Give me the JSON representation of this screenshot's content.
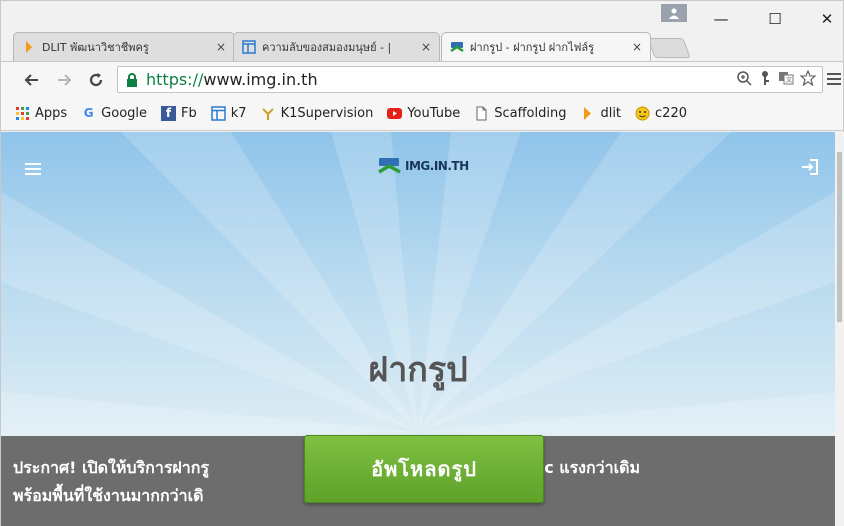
{
  "tabs": [
    {
      "title": "DLIT พัฒนาวิชาชีพครู",
      "icon": "dlit-icon",
      "close": "×",
      "active": false
    },
    {
      "title": "ความลับของสมองมนุษย์ - |",
      "icon": "page-icon",
      "close": "×",
      "active": false
    },
    {
      "title": "ฝากรูป - ฝากรูป ฝากไฟล์รู",
      "icon": "img-logo-icon",
      "close": "×",
      "active": true
    }
  ],
  "window_controls": {
    "minimize": "—",
    "maximize": "☐",
    "close": "✕"
  },
  "toolbar": {
    "url_scheme": "https://",
    "url_host": "www.img.in.th"
  },
  "bookmarks": [
    {
      "label": "Apps",
      "icon": "apps-grid-icon"
    },
    {
      "label": "Google",
      "icon": "google-icon"
    },
    {
      "label": "Fb",
      "icon": "facebook-icon"
    },
    {
      "label": "k7",
      "icon": "page-icon"
    },
    {
      "label": "K1Supervision",
      "icon": "k1-icon"
    },
    {
      "label": "YouTube",
      "icon": "youtube-icon"
    },
    {
      "label": "Scaffolding",
      "icon": "document-icon"
    },
    {
      "label": "dlit",
      "icon": "dlit-icon"
    },
    {
      "label": "c220",
      "icon": "emoji-icon"
    }
  ],
  "page": {
    "logo_text": "IMG.IN.TH",
    "hero_title": "ฝากรูป",
    "notice_line1": "ประกาศ! เปิดให้บริการฝากรู",
    "notice_line1_tail": "r ตัวใหม่ spec แรงกว่าเดิม",
    "notice_line2": "พร้อมพื้นที่ใช้งานมากกว่าเดิ",
    "upload_button": "อัพโหลดรูป"
  },
  "colors": {
    "accent_green": "#5ea22a",
    "sky_top": "#8fc4ea",
    "notice_gray": "#6d6d6d",
    "logo_navy": "#19365b"
  }
}
